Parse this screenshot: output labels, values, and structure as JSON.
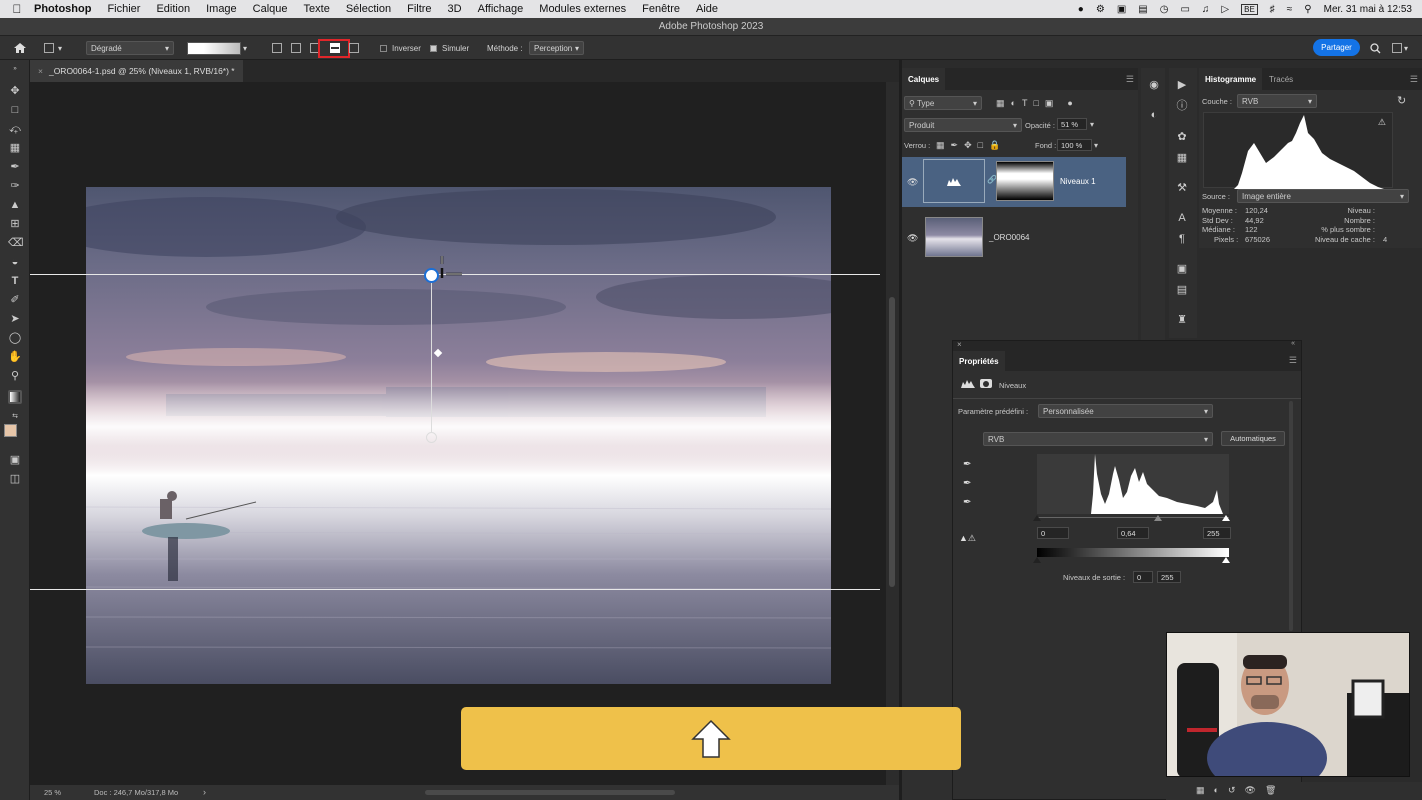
{
  "menubar": {
    "app_name": "Photoshop",
    "items": [
      "Fichier",
      "Edition",
      "Image",
      "Calque",
      "Texte",
      "Sélection",
      "Filtre",
      "3D",
      "Affichage",
      "Modules externes",
      "Fenêtre",
      "Aide"
    ],
    "keyboard_layout": "BE",
    "clock": "Mer. 31 mai à 12:53"
  },
  "window": {
    "title": "Adobe Photoshop 2023"
  },
  "options": {
    "gradient_preset": "Dégradé",
    "reverse_label": "Inverser",
    "simulate_label": "Simuler",
    "method_label": "Méthode :",
    "method_value": "Perception",
    "share_label": "Partager"
  },
  "document": {
    "tab_label": "_ORO0064-1.psd @ 25% (Niveaux 1, RVB/16*) *",
    "zoom": "25 %",
    "doc_size": "Doc : 246,7 Mo/317,8 Mo"
  },
  "layers_panel": {
    "tab": "Calques",
    "filter": "Type",
    "blend_mode": "Produit",
    "opacity_label": "Opacité :",
    "opacity_value": "51 %",
    "lock_label": "Verrou :",
    "fill_label": "Fond :",
    "fill_value": "100 %",
    "layers": [
      {
        "name": "Niveaux 1",
        "selected": true
      },
      {
        "name": "_ORO0064",
        "selected": false
      }
    ]
  },
  "histogram_panel": {
    "tabs": [
      "Histogramme",
      "Tracés"
    ],
    "channel_label": "Couche :",
    "channel_value": "RVB",
    "source_label": "Source :",
    "source_value": "Image entière",
    "stats_left": [
      {
        "label": "Moyenne :",
        "value": "120,24"
      },
      {
        "label": "Std Dev :",
        "value": "44,92"
      },
      {
        "label": "Médiane :",
        "value": "122"
      },
      {
        "label": "Pixels :",
        "value": "675026"
      }
    ],
    "stats_right": [
      {
        "label": "Niveau :",
        "value": ""
      },
      {
        "label": "Nombre :",
        "value": ""
      },
      {
        "label": "% plus sombre :",
        "value": ""
      },
      {
        "label": "Niveau de cache :",
        "value": "4"
      }
    ]
  },
  "properties_panel": {
    "title": "Propriétés",
    "adjustment": "Niveaux",
    "preset_label": "Paramètre prédéfini :",
    "preset_value": "Personnalisée",
    "channel_value": "RVB",
    "auto_button": "Automatiques",
    "input_black": "0",
    "input_gamma": "0,64",
    "input_white": "255",
    "output_label": "Niveaux de sortie :",
    "output_black": "0",
    "output_white": "255"
  },
  "colors": {
    "accent": "#1473e6",
    "banner": "#efc14a",
    "selected_layer": "#4a6282"
  }
}
